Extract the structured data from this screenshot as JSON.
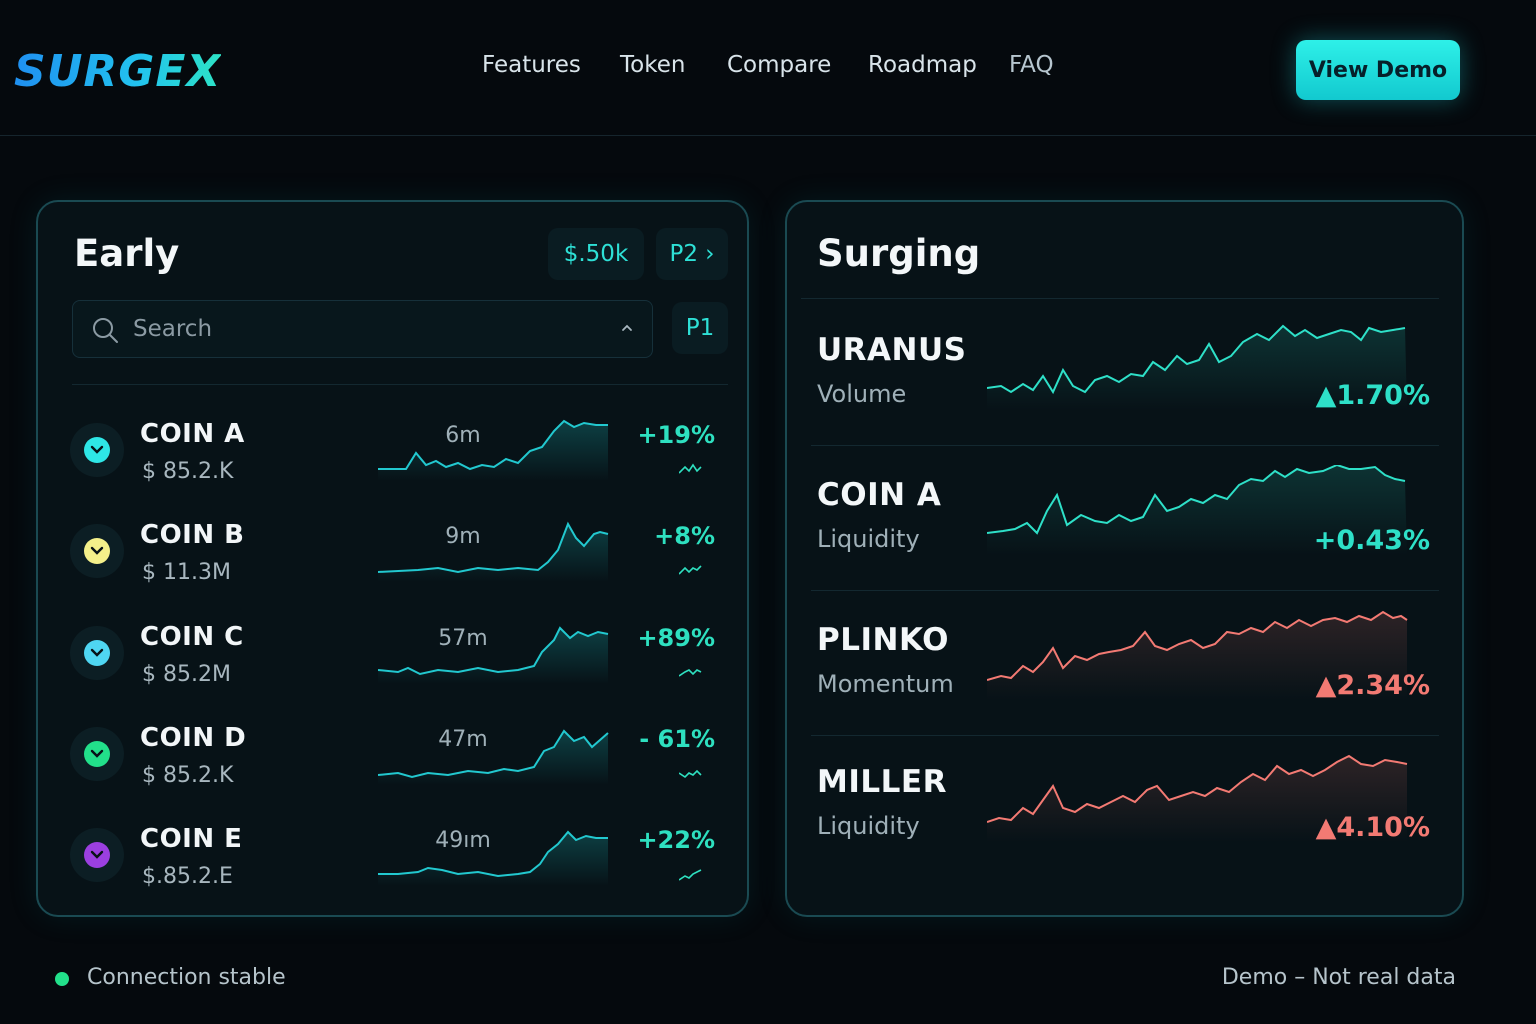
{
  "brand": {
    "logo_text": "SURGEX"
  },
  "nav": {
    "links": [
      "Features",
      "Token",
      "Compare",
      "Roadmap",
      "FAQ"
    ],
    "cta_label": "View Demo"
  },
  "early_panel": {
    "title": "Early",
    "filter_chip": "$.50k",
    "page_next": "P2 ›",
    "page_current": "P1",
    "search_placeholder": "Search",
    "coins": [
      {
        "name": "COIN A",
        "price": "$ 85.2.K",
        "age": "6m",
        "change": "+19%",
        "color": "#2ee6e6",
        "icon": "chevron-down-icon"
      },
      {
        "name": "COIN B",
        "price": "$ 11.3M",
        "age": "9m",
        "change": "+8%",
        "color": "#f4f08a",
        "icon": "chevron-down-icon"
      },
      {
        "name": "COIN C",
        "price": "$ 85.2M",
        "age": "57m",
        "change": "+89%",
        "color": "#4fd6f2",
        "icon": "chevron-down-icon"
      },
      {
        "name": "COIN D",
        "price": "$ 85.2.K",
        "age": "47m",
        "change": "- 61%",
        "color": "#22e08a",
        "icon": "chevron-down-icon"
      },
      {
        "name": "COIN E",
        "price": "$.85.2.E",
        "age": "49ım",
        "change": "+22%",
        "color": "#9b3fe0",
        "icon": "chevron-down-icon"
      }
    ]
  },
  "surging_panel": {
    "title": "Surging",
    "items": [
      {
        "name": "URANUS",
        "metric": "Volume",
        "change": "▲1.70%",
        "trend": "up",
        "color": "#2ee0c8"
      },
      {
        "name": "COIN A",
        "metric": "Liquidity",
        "change": "+0.43%",
        "trend": "up",
        "color": "#2ee0c8"
      },
      {
        "name": "PLINKO",
        "metric": "Momentum",
        "change": "▲2.34%",
        "trend": "up",
        "color": "#f37a73"
      },
      {
        "name": "MILLER",
        "metric": "Liquidity",
        "change": "▲4.10%",
        "trend": "up",
        "color": "#f37a73"
      }
    ]
  },
  "footer": {
    "status": "Connection stable",
    "disclaimer": "Demo – Not real data"
  },
  "colors": {
    "accent": "#2ee0d6",
    "up": "#2ee0c8",
    "hot": "#f37a73",
    "status_ok": "#22e08a"
  }
}
